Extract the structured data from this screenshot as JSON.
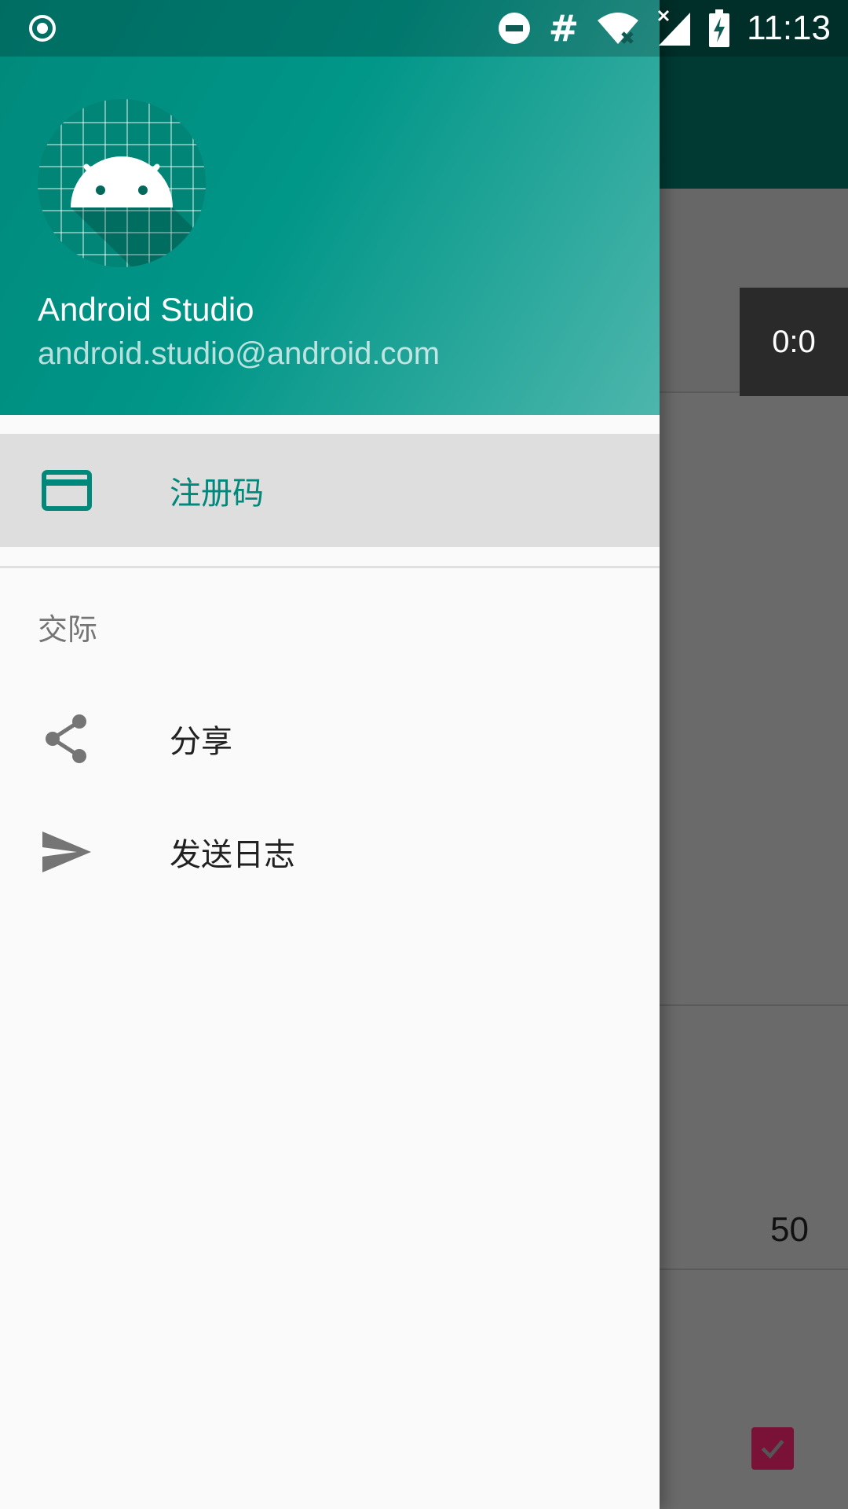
{
  "status_bar": {
    "time": "11:13",
    "icons": [
      "record-icon",
      "do-not-disturb-icon",
      "hash-icon",
      "wifi-off-icon",
      "signal-icon",
      "battery-charging-icon"
    ]
  },
  "drawer": {
    "header": {
      "name": "Android Studio",
      "email": "android.studio@android.com",
      "avatar_icon": "android-avatar-icon"
    },
    "items": [
      {
        "label": "注册码",
        "icon": "credit-card-icon",
        "selected": true
      }
    ],
    "section": {
      "title": "交际",
      "items": [
        {
          "label": "分享",
          "icon": "share-icon"
        },
        {
          "label": "发送日志",
          "icon": "send-icon"
        }
      ]
    }
  },
  "background_app": {
    "timer_text": "0:0",
    "value_text": "50",
    "checkbox_checked": true
  },
  "colors": {
    "accent": "#00897b",
    "header_gradient_start": "#00897b",
    "header_gradient_end": "#4db6ac",
    "checkbox": "#7a1238"
  }
}
